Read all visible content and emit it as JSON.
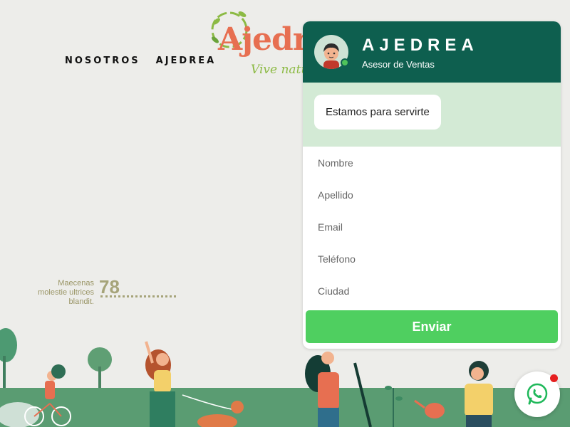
{
  "nav": {
    "items": [
      {
        "label": "NOSOTROS"
      },
      {
        "label": "AJEDREA"
      }
    ]
  },
  "logo": {
    "text": "Ajedrea",
    "tagline": "Vive natural"
  },
  "stat": {
    "label": "Maecenas molestie ultrices blandit.",
    "value": "78"
  },
  "chat": {
    "title": "AJEDREA",
    "subtitle": "Asesor de Ventas",
    "status_color": "#4fc35a",
    "welcome": "Estamos para servirte",
    "fields": [
      {
        "placeholder": "Nombre"
      },
      {
        "placeholder": "Apellido"
      },
      {
        "placeholder": "Email"
      },
      {
        "placeholder": "Teléfono"
      },
      {
        "placeholder": "Ciudad"
      }
    ],
    "submit_label": "Enviar"
  },
  "whatsapp": {
    "icon": "whatsapp-icon",
    "notification_color": "#e51f1f"
  },
  "colors": {
    "header": "#0e5f4f",
    "chat_body": "#d3ead5",
    "button": "#4fcf60",
    "ground": "#5a9c72"
  }
}
